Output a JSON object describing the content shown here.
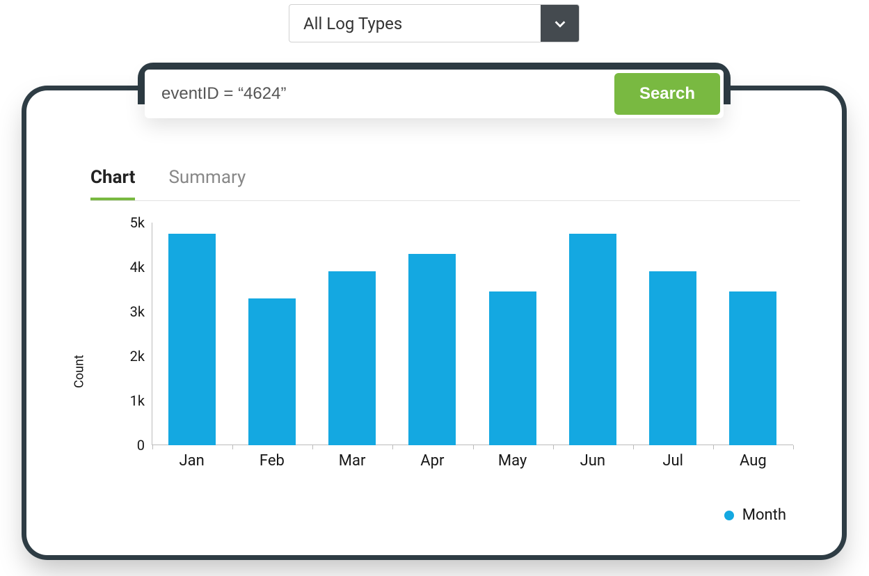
{
  "logtype": {
    "selected": "All Log Types"
  },
  "search": {
    "query": "eventID = “4624”",
    "button": "Search"
  },
  "tabs": {
    "items": [
      "Chart",
      "Summary"
    ],
    "active": 0
  },
  "legend": {
    "label": "Month"
  },
  "chart_data": {
    "type": "bar",
    "ylabel": "Count",
    "ylim": [
      0,
      5000
    ],
    "yticks": [
      0,
      1000,
      2000,
      3000,
      4000,
      5000
    ],
    "ytick_labels": [
      "0",
      "1k",
      "2k",
      "3k",
      "4k",
      "5k"
    ],
    "categories": [
      "Jan",
      "Feb",
      "Mar",
      "Apr",
      "May",
      "Jun",
      "Jul",
      "Aug"
    ],
    "values": [
      4750,
      3300,
      3900,
      4300,
      3450,
      4750,
      3900,
      3450
    ],
    "series_name": "Month",
    "series_color": "#14a8e1"
  }
}
